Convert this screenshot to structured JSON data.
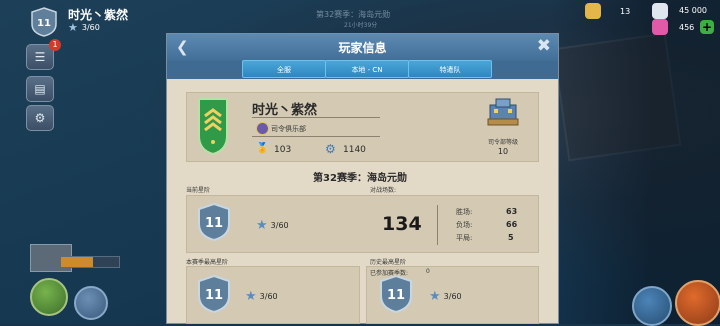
{
  "hud": {
    "rank": "11",
    "player_name": "时光丶紫然",
    "stars": "3/60",
    "notification_count": "1"
  },
  "resources": {
    "key_count": "13",
    "diamond_count": "45 000",
    "gem_count": "456"
  },
  "event_banner": {
    "line1": "第32赛季：海岛元勋",
    "line2": "21小时39分"
  },
  "panel": {
    "title": "玩家信息",
    "tabs": [
      "全服",
      "本地 - CN",
      "特遣队"
    ]
  },
  "player": {
    "name": "时光丶紫然",
    "club": "司令俱乐部",
    "medals": "103",
    "parts": "1140",
    "hq_label": "司令部等级",
    "hq_level": "10"
  },
  "season_title": "第32赛季：海岛元勋",
  "current": {
    "label": "当前星阶",
    "rank": "11",
    "stars": "3/60",
    "battles_label": "对战场数:",
    "battles": "134",
    "wins_label": "胜场:",
    "wins": "63",
    "losses_label": "负场:",
    "losses": "66",
    "draws_label": "平局:",
    "draws": "5"
  },
  "season_best": {
    "label": "本赛季最高星阶",
    "rank": "11",
    "stars": "3/60"
  },
  "history_best": {
    "label": "历史最高星阶",
    "seasons_label": "已参加赛季数:",
    "seasons": "0",
    "rank": "11",
    "stars": "3/60"
  },
  "colors": {
    "panel_header": "#4f7ea8",
    "tab_active": "#3a95cc",
    "panel_bg": "#e2d9c6",
    "badge_green": "#2f9a47",
    "shield_blue": "#5d7f9c"
  }
}
